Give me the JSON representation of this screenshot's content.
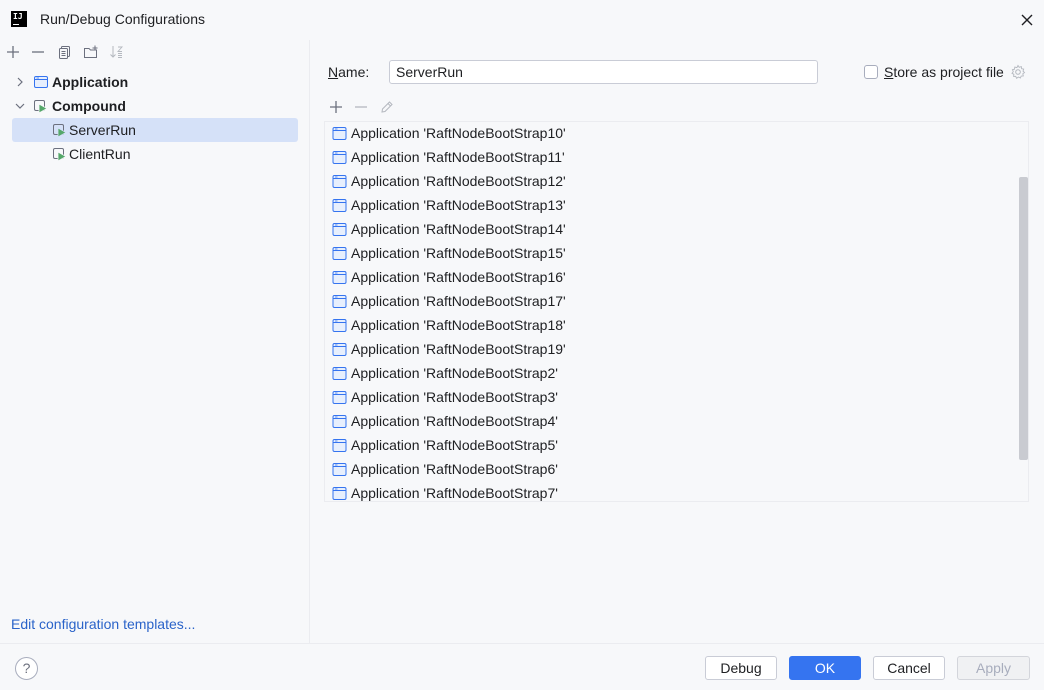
{
  "window": {
    "title": "Run/Debug Configurations"
  },
  "tree": {
    "items": [
      {
        "label": "Application",
        "bold": true,
        "expanded": false
      },
      {
        "label": "Compound",
        "bold": true,
        "expanded": true
      },
      {
        "label": "ServerRun",
        "bold": false,
        "selected": true
      },
      {
        "label": "ClientRun",
        "bold": false
      }
    ]
  },
  "templates_link": "Edit configuration templates...",
  "form": {
    "name_label_mnemonic": "N",
    "name_label_rest": "ame:",
    "name_value": "ServerRun",
    "store_label_mnemonic": "S",
    "store_label_rest": "tore as project file",
    "store_checked": false
  },
  "configs": [
    "Application 'RaftNodeBootStrap10'",
    "Application 'RaftNodeBootStrap11'",
    "Application 'RaftNodeBootStrap12'",
    "Application 'RaftNodeBootStrap13'",
    "Application 'RaftNodeBootStrap14'",
    "Application 'RaftNodeBootStrap15'",
    "Application 'RaftNodeBootStrap16'",
    "Application 'RaftNodeBootStrap17'",
    "Application 'RaftNodeBootStrap18'",
    "Application 'RaftNodeBootStrap19'",
    "Application 'RaftNodeBootStrap2'",
    "Application 'RaftNodeBootStrap3'",
    "Application 'RaftNodeBootStrap4'",
    "Application 'RaftNodeBootStrap5'",
    "Application 'RaftNodeBootStrap6'",
    "Application 'RaftNodeBootStrap7'"
  ],
  "footer": {
    "help": "?",
    "debug": "Debug",
    "ok": "OK",
    "cancel": "Cancel",
    "apply": "Apply"
  },
  "colors": {
    "accent": "#3574f0",
    "selection": "#d5e1f8",
    "link": "#2a63c9"
  }
}
